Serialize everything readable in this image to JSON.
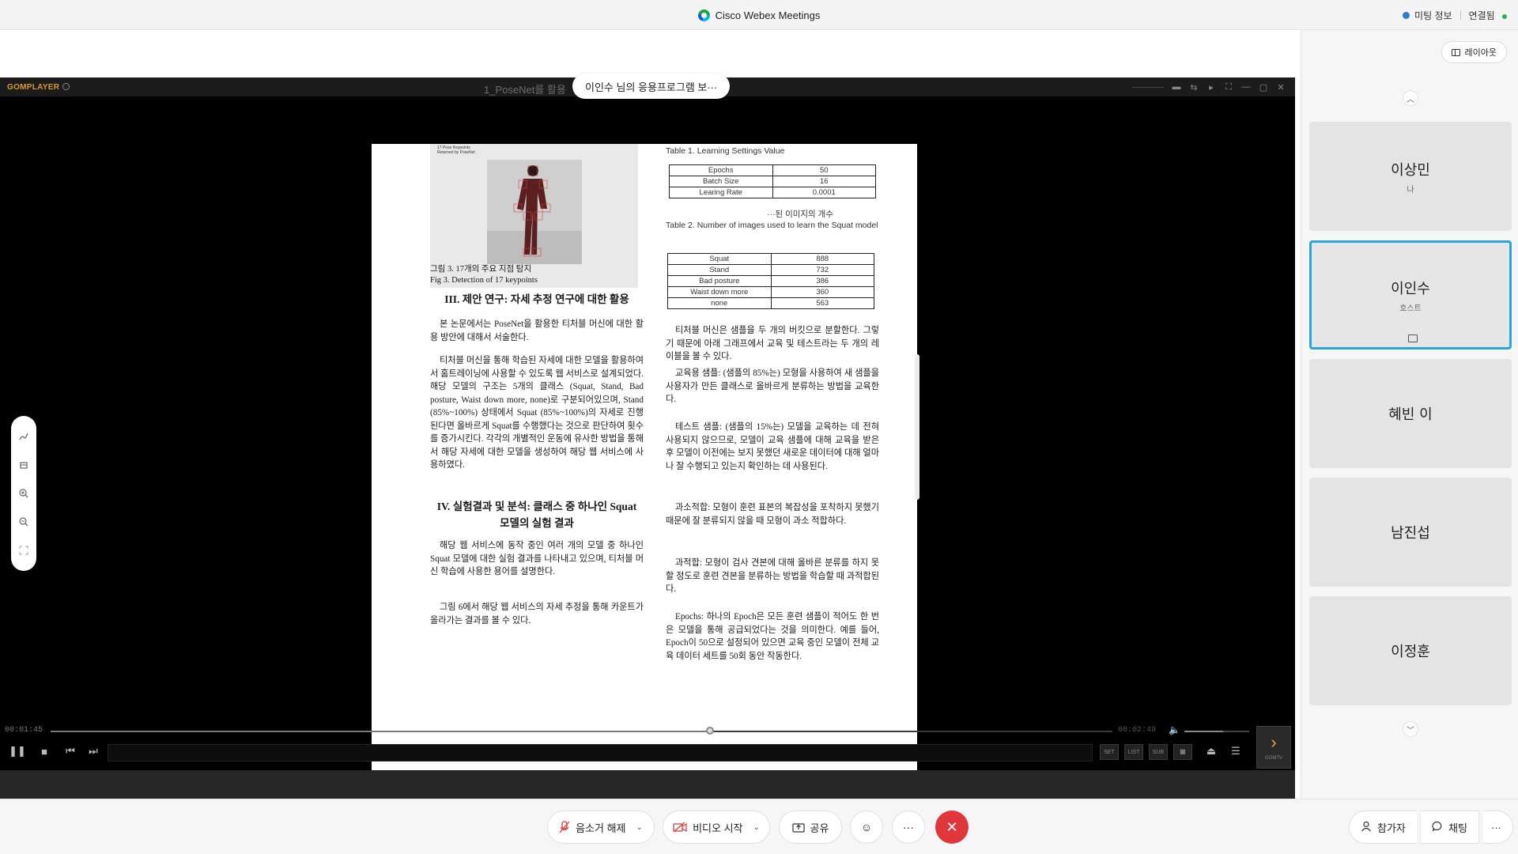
{
  "app": {
    "title": "Cisco Webex Meetings",
    "meeting_info_label": "미팅 정보",
    "connection_label": "연결됨",
    "brand_green": "#2bb24c",
    "accent_blue": "#2aa3e0",
    "end_red": "#e0373c"
  },
  "share": {
    "banner": "이인수 님의 응용프로그램 보···"
  },
  "gom": {
    "logo": "GOMPLAYER",
    "filename": "1_PoseNet를 활용",
    "elapsed": "00:01:45",
    "total": "00:02:49",
    "progress": 0.621,
    "volume": 0.6,
    "buttons": {
      "settings_label": "SET",
      "playlist_label": "LIST",
      "subtitle_label": "SUB",
      "next_label": "GOMTV"
    }
  },
  "document": {
    "figure_tag": "17 Pose Keypoints\nReturned by PoseNet",
    "figure_caption_kr": "그림 3. 17개의 주요 지점 탐지",
    "figure_caption_en": "Fig 3. Detection of 17 keypoints",
    "section3_title": "III. 제안 연구: 자세 추정 연구에 대한 활용",
    "section3_p1": "본 논문에서는 PoseNet을 활용한 티처블 머신에 대한 활용 방안에 대해서 서술한다.",
    "section3_p2": "티처블 머신을 통해 학습된 자세에 대한 모델을 활용하여서 홈트레이닝에 사용할 수 있도록 웹 서비스로 설계되었다. 해당 모델의 구조는 5개의 클래스 (Squat, Stand, Bad posture, Waist down more, none)로 구분되어있으며, Stand (85%~100%) 상태에서 Squat (85%~100%)의 자세로 진행된다면 올바르게 Squat를 수행했다는 것으로 판단하여 횟수를 증가시킨다. 각각의 개별적인 운동에 유사한 방법을 통해서 해당 자세에 대한 모델을 생성하여 해당 웹 서비스에 사용하였다.",
    "section4_title_line1": "IV. 실험결과 및 분석: 클래스 중 하나인 Squat",
    "section4_title_line2": "모델의 실험 결과",
    "section4_p1": "해당 웹 서비스에 동작 중인 여러 개의 모델 중 하나인 Squat 모델에 대한 실험 결과를 나타내고 있으며, 티처블 머신 학습에 사용한 용어를 설명한다.",
    "section4_p2": "그림 6에서 해당 웹 서비스의 자세 추정을 통해 카운트가 올라가는 결과를 볼 수 있다.",
    "table1_caption": "Table 1. Learning Settings Value",
    "table1": [
      [
        "Epochs",
        "50"
      ],
      [
        "Batch Size",
        "16"
      ],
      [
        "Learing Rate",
        "0.0001"
      ]
    ],
    "table2_caption_kr": "···된 이미지의 개수",
    "table2_caption_en": "Table 2. Number of images used to learn the Squat model",
    "table2": [
      [
        "Squat",
        "888"
      ],
      [
        "Stand",
        "732"
      ],
      [
        "Bad posture",
        "386"
      ],
      [
        "Waist down more",
        "360"
      ],
      [
        "none",
        "563"
      ]
    ],
    "right_p1": "티처블 머신은 샘플을 두 개의 버킷으로 분할한다. 그렇기 때문에 아래 그래프에서 교육 및 테스트라는 두 개의 레이블을 볼 수 있다.",
    "right_p2": "교육용 샘플: (샘플의 85%는) 모형을 사용하여 새 샘플을 사용자가 만든 클래스로 올바르게 분류하는 방법을 교육한다.",
    "right_p3": "테스트 샘플: (샘플의 15%는) 모델을 교육하는 데 전혀 사용되지 않으므로, 모델이 교육 샘플에 대해 교육을 받은 후 모델이 이전에는 보지 못했던 새로운 데이터에 대해 얼마나 잘 수행되고 있는지 확인하는 데 사용된다.",
    "right_p4": "과소적합: 모형이 훈련 표본의 복잡성을 포착하지 못했기 때문에 잘 분류되지 않을 때 모형이 과소 적합하다.",
    "right_p5": "과적합: 모형이 검사 견본에 대해 올바른 분류를 하지 못할 정도로 훈련 견본을 분류하는 방법을 학습할 때 과적합된다.",
    "right_p6": "Epochs: 하나의 Epoch은 모든 훈련 샘플이 적어도 한 번은 모델을 통해 공급되었다는 것을 의미한다. 예를 들어, Epoch이 50으로 설정되어 있으면 교육 중인 모델이 전체 교육 데이터 세트를 50회 동안 작동한다."
  },
  "participants_panel": {
    "layout_label": "레이아웃",
    "tiles": [
      {
        "name": "이상민",
        "sub": "나",
        "active": false
      },
      {
        "name": "이인수",
        "sub": "호스트",
        "active": true
      },
      {
        "name": "혜빈 이",
        "sub": "",
        "active": false
      },
      {
        "name": "남진섭",
        "sub": "",
        "active": false
      },
      {
        "name": "이정훈",
        "sub": "",
        "active": false
      }
    ]
  },
  "bottombar": {
    "unmute_label": "음소거 해제",
    "video_label": "비디오 시작",
    "share_label": "공유",
    "participants_label": "참가자",
    "chat_label": "채팅"
  }
}
